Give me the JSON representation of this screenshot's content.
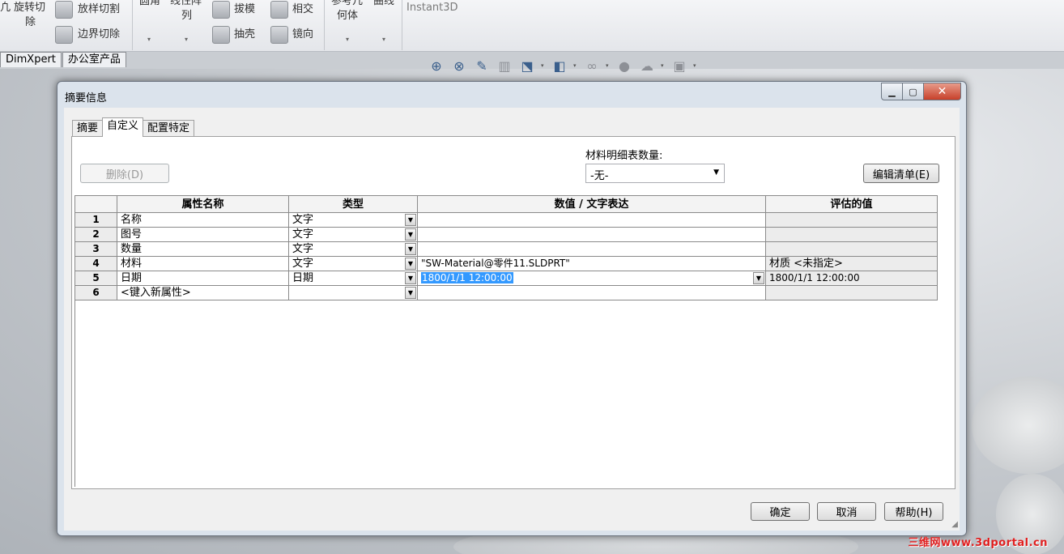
{
  "ribbon": {
    "revolve_cut_line1": "旋转切",
    "revolve_cut_line2": "除",
    "revolve_cut_prefix": "凢",
    "loft_cut": "放样切割",
    "boundary_cut": "边界切除",
    "fillet": "圆角",
    "linear_pattern_line1": "线性阵",
    "linear_pattern_line2": "列",
    "draft": "拔模",
    "shell": "抽壳",
    "intersect": "相交",
    "mirror": "镜向",
    "ref_geometry_line1": "参考几",
    "ref_geometry_line2": "何体",
    "curves": "曲线",
    "instant3d": "Instant3D"
  },
  "command_tabs": [
    "DimXpert",
    "办公室产品"
  ],
  "dialog": {
    "title": "摘要信息",
    "tabs": [
      {
        "label": "摘要",
        "active": false
      },
      {
        "label": "自定义",
        "active": true
      },
      {
        "label": "配置特定",
        "active": false
      }
    ],
    "delete_button": "删除(D)",
    "bom_quantity_label": "材料明细表数量:",
    "bom_quantity_value": "-无-",
    "edit_list_button": "编辑清单(E)",
    "grid": {
      "columns": [
        "属性名称",
        "类型",
        "数值 / 文字表达",
        "评估的值"
      ],
      "rows": [
        {
          "num": "1",
          "name": "名称",
          "type": "文字",
          "value": "",
          "evaluated": ""
        },
        {
          "num": "2",
          "name": "图号",
          "type": "文字",
          "value": "",
          "evaluated": ""
        },
        {
          "num": "3",
          "name": "数量",
          "type": "文字",
          "value": "",
          "evaluated": ""
        },
        {
          "num": "4",
          "name": "材料",
          "type": "文字",
          "value": "\"SW-Material@零件11.SLDPRT\"",
          "evaluated": "材质 <未指定>"
        },
        {
          "num": "5",
          "name": "日期",
          "type": "日期",
          "value": "1800/1/1 12:00:00",
          "evaluated": "1800/1/1 12:00:00"
        },
        {
          "num": "6",
          "name": "<键入新属性>",
          "type": "",
          "value": "",
          "evaluated": ""
        }
      ]
    },
    "ok_button": "确定",
    "cancel_button": "取消",
    "help_button": "帮助(H)"
  },
  "watermark": "三维网www.3dportal.cn",
  "icons": {
    "hud": [
      "zoom-to-fit-icon",
      "zoom-area-icon",
      "previous-view-icon",
      "section-view-icon",
      "view-orientation-icon",
      "display-style-icon",
      "hide-show-icon",
      "edit-appearance-icon",
      "apply-scene-icon",
      "view-settings-icon"
    ]
  }
}
